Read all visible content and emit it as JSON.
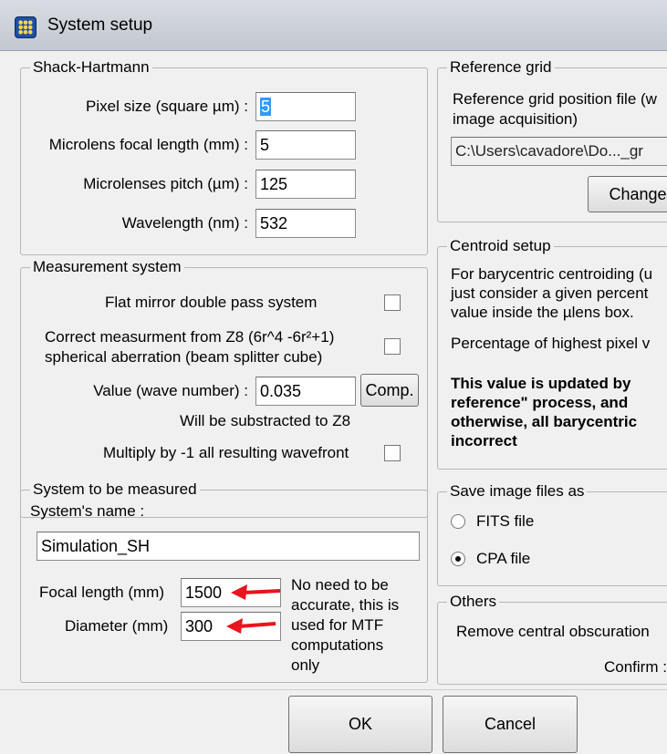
{
  "window": {
    "title": "System setup"
  },
  "shack_hartmann": {
    "legend": "Shack-Hartmann",
    "pixel_size_label": "Pixel size (square µm) :",
    "pixel_size_value": "5",
    "focal_length_label": "Microlens focal length (mm) :",
    "focal_length_value": "5",
    "pitch_label": "Microlenses pitch (µm) :",
    "pitch_value": "125",
    "wavelength_label": "Wavelength (nm) :",
    "wavelength_value": "532"
  },
  "measurement_system": {
    "legend": "Measurement system",
    "flat_mirror_label": "Flat mirror double pass system",
    "correct_z8_label_1": "Correct measurment from Z8 (6r^4 -6r²+1)",
    "correct_z8_label_2": "spherical aberration (beam splitter cube)",
    "value_label": "Value (wave number) :",
    "value": "0.035",
    "comp_button": "Comp.",
    "subtracted_note": "Will be substracted to Z8",
    "multiply_label": "Multiply by -1 all resulting wavefront"
  },
  "system_measured": {
    "legend": "System to be measured",
    "name_label": "System's name :",
    "name_value": "Simulation_SH",
    "focal_label": "Focal length (mm)",
    "focal_value": "1500",
    "diameter_label": "Diameter (mm)",
    "diameter_value": "300",
    "note_lines": [
      "No need to be",
      "accurate, this is",
      "used for MTF",
      "computations",
      "only"
    ]
  },
  "reference_grid": {
    "legend": "Reference grid",
    "desc_1": "Reference grid position file (w",
    "desc_2": "image acquisition)",
    "file_path": "C:\\Users\\cavadore\\Do..._gr",
    "change_button": "Change"
  },
  "centroid_setup": {
    "legend": "Centroid setup",
    "desc_1": "For barycentric centroiding (u",
    "desc_2": "just consider a given percent",
    "desc_3": "value inside the µlens box.",
    "percentage_label": "Percentage of highest pixel v",
    "warn_1": "This value is updated by",
    "warn_2": "reference\" process, and",
    "warn_3": "otherwise, all barycentric",
    "warn_4": "incorrect"
  },
  "save_images": {
    "legend": "Save image files as",
    "fits_label": "FITS file",
    "cpa_label": "CPA file",
    "selected": "CPA file"
  },
  "others": {
    "legend": "Others",
    "obscuration_label": "Remove central obscuration",
    "confirm_label": "Confirm :"
  },
  "footer": {
    "ok_button": "OK",
    "cancel_button": "Cancel"
  },
  "colors": {
    "accent_arrow": "#e8141e",
    "selection": "#3399ff"
  }
}
